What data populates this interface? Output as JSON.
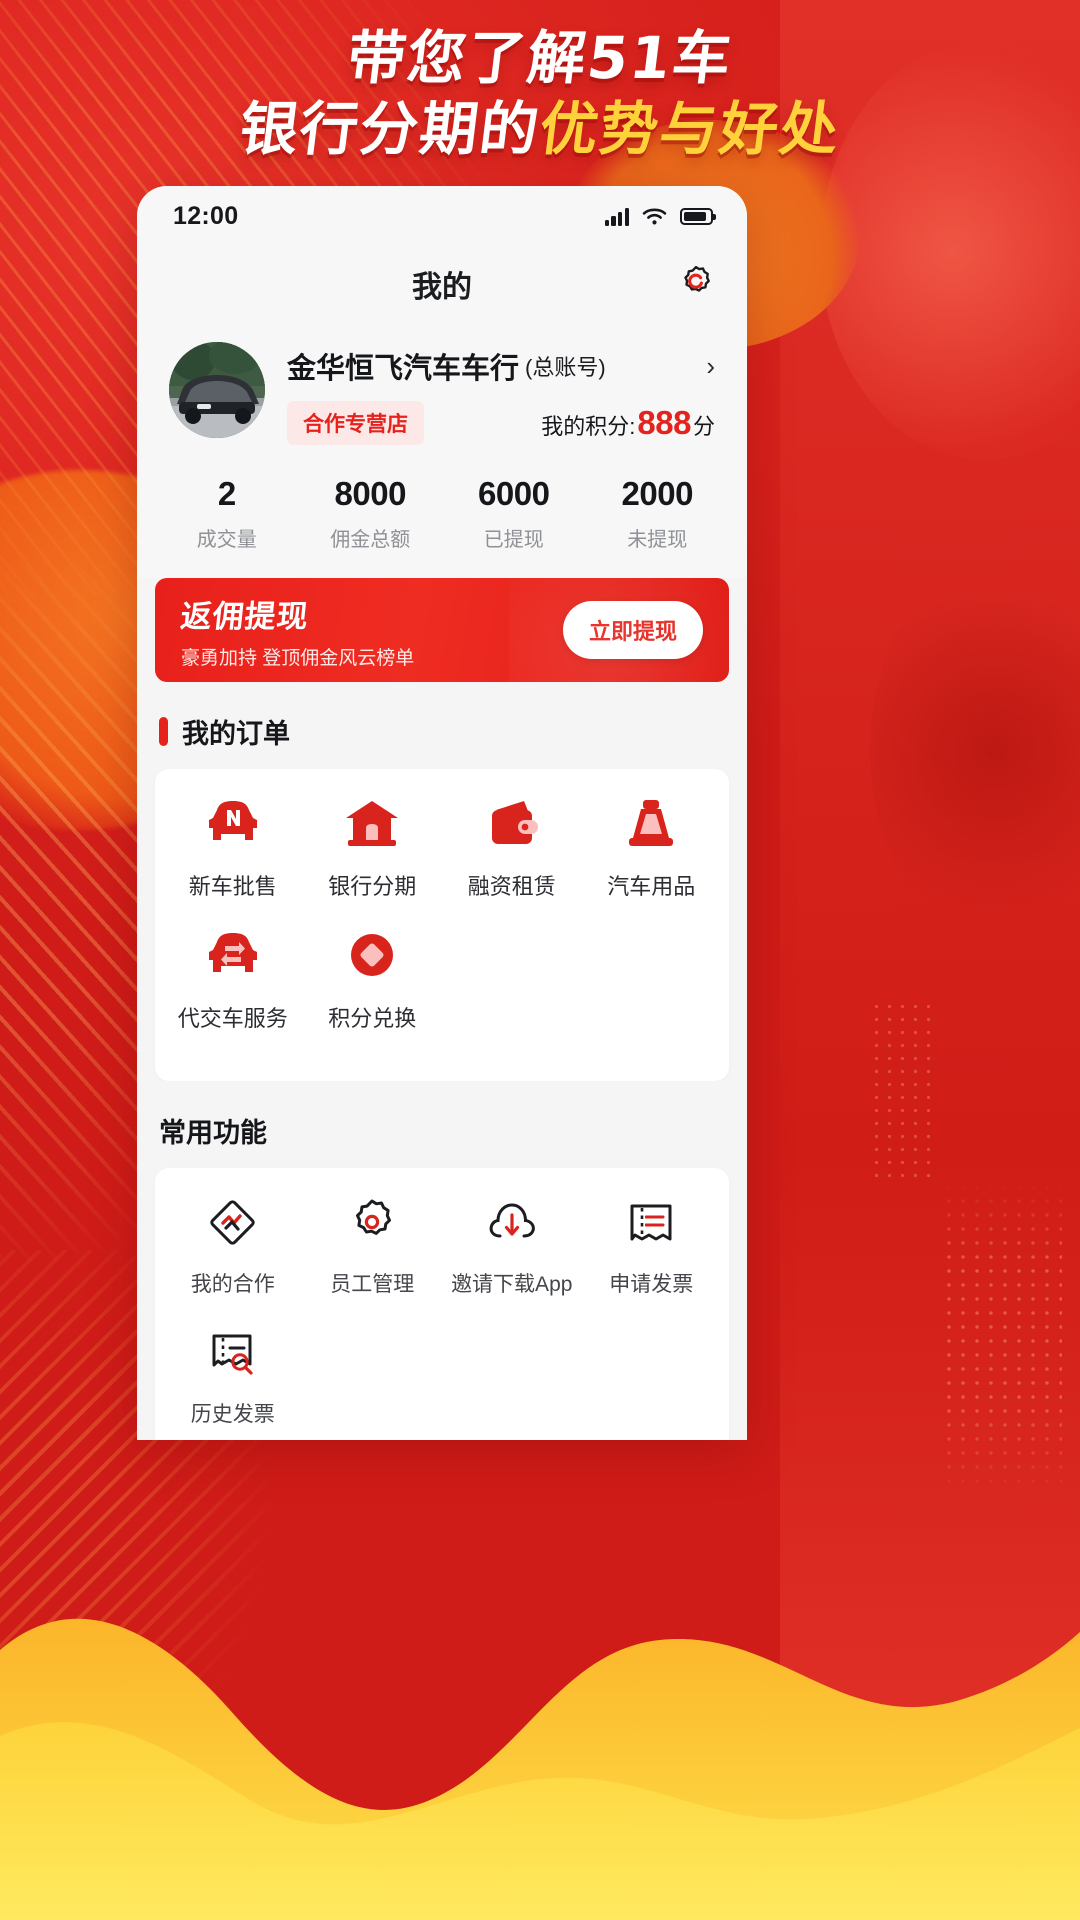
{
  "poster": {
    "headline_line1": "带您了解51车",
    "headline_line2_plain": "银行分期的",
    "headline_line2_accent": "优势与好处"
  },
  "colors": {
    "brand_red": "#e5231c",
    "banner_red": "#e8201b",
    "accent_yellow": "#ffd23b",
    "text_dark": "#15171b",
    "text_muted": "#8f9196"
  },
  "statusbar": {
    "time": "12:00",
    "signal_icon": "signal-bars-icon",
    "wifi_icon": "wifi-icon",
    "battery_icon": "battery-icon"
  },
  "navbar": {
    "title": "我的",
    "settings_icon": "gear-icon"
  },
  "profile": {
    "avatar_icon": "car-avatar",
    "shop_name": "金华恒飞汽车车行",
    "account_type": "(总账号)",
    "chevron": "›",
    "badge": "合作专营店",
    "points_label": "我的积分:",
    "points_value": "888",
    "points_unit": "分"
  },
  "stats": [
    {
      "value": "2",
      "label": "成交量"
    },
    {
      "value": "8000",
      "label": "佣金总额"
    },
    {
      "value": "6000",
      "label": "已提现"
    },
    {
      "value": "2000",
      "label": "未提现"
    }
  ],
  "promo": {
    "title": "返佣提现",
    "subtitle": "豪勇加持 登顶佣金风云榜单",
    "button": "立即提现"
  },
  "orders": {
    "section_title": "我的订单",
    "items": [
      {
        "label": "新车批售",
        "icon": "car-icon"
      },
      {
        "label": "银行分期",
        "icon": "bank-icon"
      },
      {
        "label": "融资租赁",
        "icon": "wallet-icon"
      },
      {
        "label": "汽车用品",
        "icon": "car-product-icon"
      },
      {
        "label": "代交车服务",
        "icon": "car-exchange-icon"
      },
      {
        "label": "积分兑换",
        "icon": "points-diamond-icon"
      }
    ]
  },
  "functions": {
    "section_title": "常用功能",
    "items": [
      {
        "label": "我的合作",
        "icon": "handshake-diamond-icon"
      },
      {
        "label": "员工管理",
        "icon": "gear-staff-icon"
      },
      {
        "label": "邀请下载App",
        "icon": "cloud-download-icon"
      },
      {
        "label": "申请发票",
        "icon": "invoice-icon"
      },
      {
        "label": "历史发票",
        "icon": "invoice-search-icon"
      }
    ]
  }
}
